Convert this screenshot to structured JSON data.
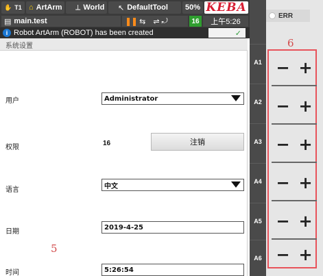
{
  "topbar": {
    "t1": "T1",
    "robot": "ArtArm",
    "coord": "World",
    "tool": "DefaultTool",
    "speed": "50%",
    "logo": "KEBA",
    "program": "main.test",
    "count": "16",
    "clock": "上午5:26"
  },
  "message": {
    "text": "Robot ArtArm (ROBOT) has been created",
    "ack": "✓"
  },
  "panel": {
    "title": "系统设置",
    "user_label": "用户",
    "user_value": "Administrator",
    "rights_label": "权限",
    "rights_value": "16",
    "logout_label": "注销",
    "lang_label": "语言",
    "lang_value": "中文",
    "date_label": "日期",
    "date_value": "2019-4-25",
    "time_label": "时间",
    "time_value": "5:26:54"
  },
  "annotations": {
    "left": "5",
    "right": "6"
  },
  "axes": [
    "A1",
    "A2",
    "A3",
    "A4",
    "A5",
    "A6"
  ],
  "err": "ERR",
  "jog": {
    "minus": "−",
    "plus": "+"
  },
  "colors": {
    "accent_red": "#d71e33",
    "frame_red": "#e8525a",
    "ok_green": "#2e9b3a",
    "info_blue": "#1976d2"
  }
}
